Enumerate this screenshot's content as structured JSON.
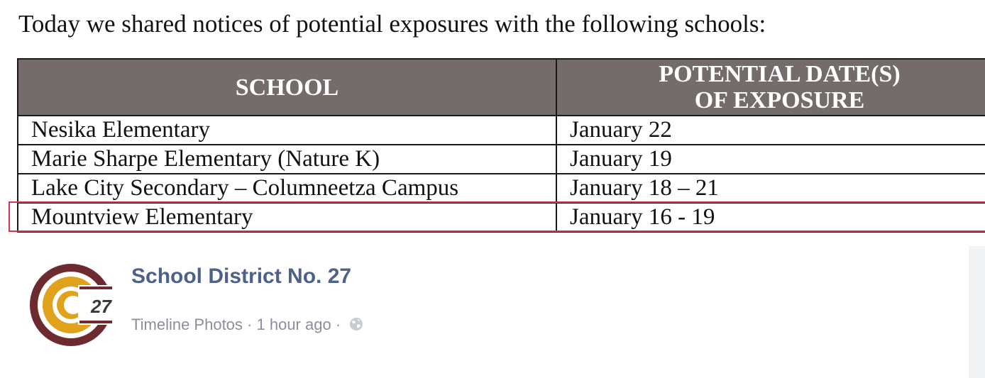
{
  "post_image": {
    "intro_text": "Today we shared notices of potential exposures with the following schools:",
    "table": {
      "headers": [
        "SCHOOL",
        "POTENTIAL DATE(S)\nOF EXPOSURE"
      ],
      "rows": [
        [
          "Nesika Elementary",
          "January 22"
        ],
        [
          "Marie Sharpe Elementary (Nature K)",
          "January 19"
        ],
        [
          "Lake City Secondary – Columneetza Campus",
          "January 18 – 21"
        ],
        [
          "Mountview Elementary",
          "January 16 - 19"
        ]
      ]
    },
    "highlight_color": "#d9344b",
    "header_bg_color": "#746b6b"
  },
  "post_meta": {
    "page_name": "School District No. 27",
    "source": "Timeline Photos",
    "separator": "·",
    "time": "1 hour ago",
    "privacy_icon": "globe-icon",
    "name_color": "#4e6289"
  },
  "logo": {
    "icon": "sd27-logo-icon",
    "text": "27",
    "colors": {
      "ring": "#6e2b2f",
      "gold": "#e0a21c"
    }
  }
}
